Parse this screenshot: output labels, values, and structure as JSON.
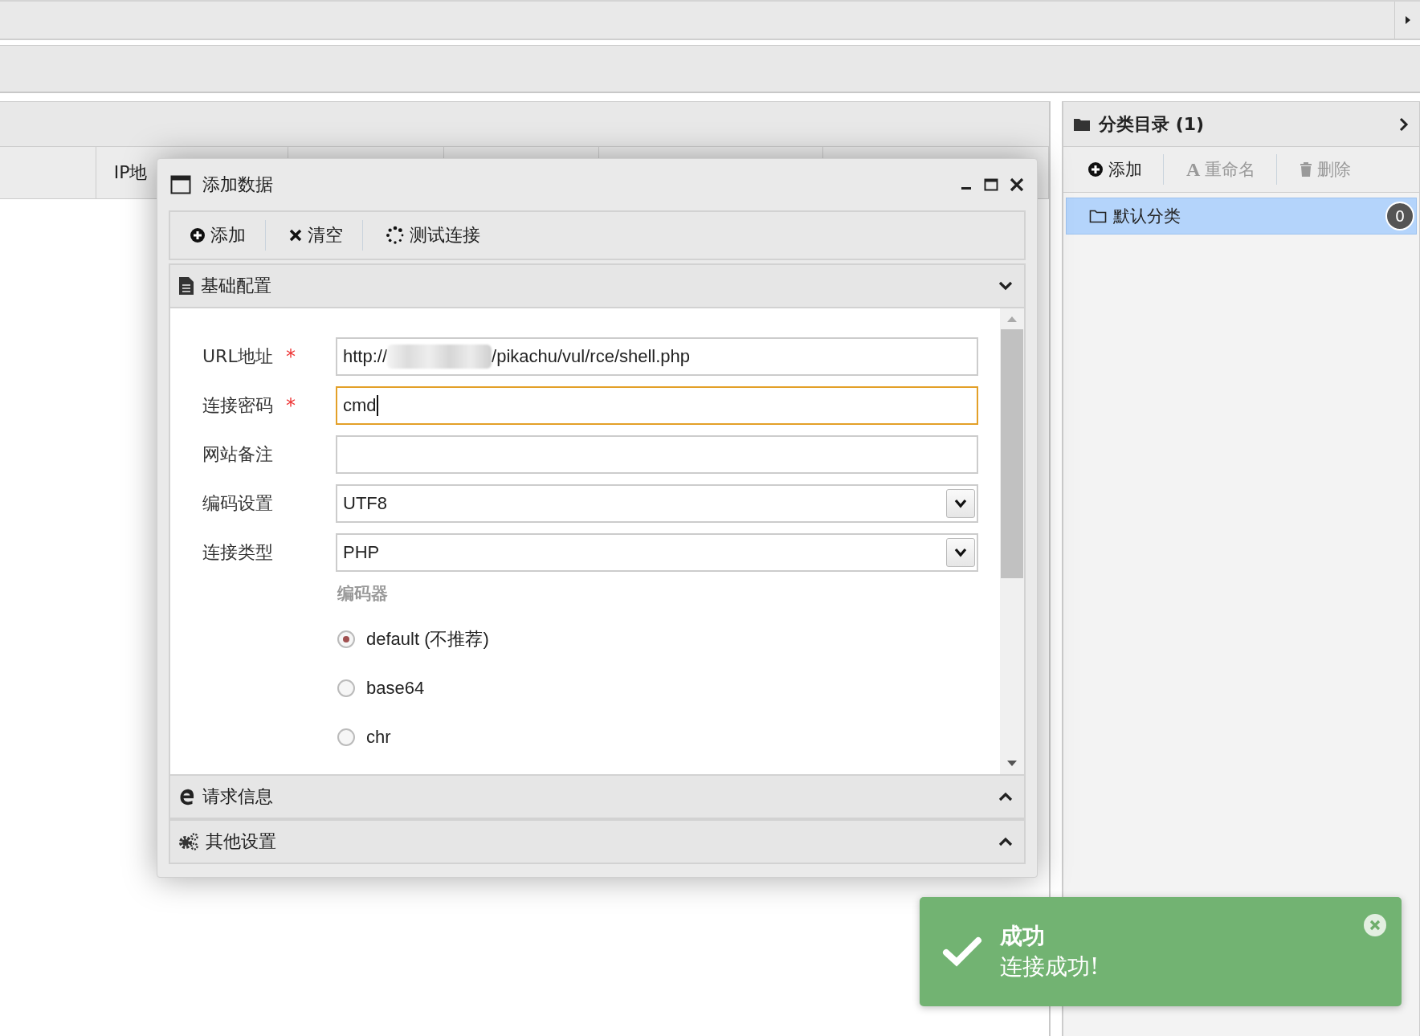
{
  "table": {
    "columns": [
      {},
      {
        "label": "IP地"
      },
      {},
      {},
      {},
      {}
    ]
  },
  "category_panel": {
    "title": "分类目录 (1)",
    "toolbar": [
      {
        "kind": "add",
        "label": "添加",
        "disabled": false
      },
      {
        "kind": "rename",
        "glyph": "A",
        "label": "重命名",
        "disabled": true
      },
      {
        "kind": "delete",
        "label": "删除",
        "disabled": true
      }
    ],
    "items": [
      {
        "label": "默认分类",
        "count": "0",
        "selected": true
      }
    ]
  },
  "dialog": {
    "title": "添加数据",
    "toolbar": [
      {
        "kind": "add",
        "label": "添加"
      },
      {
        "kind": "clear",
        "label": "清空"
      },
      {
        "kind": "test",
        "label": "测试连接"
      }
    ],
    "sections": [
      {
        "kind": "basic",
        "title": "基础配置",
        "expanded": true
      },
      {
        "kind": "request",
        "title": "请求信息",
        "expanded": false
      },
      {
        "kind": "other",
        "title": "其他设置",
        "expanded": false
      }
    ],
    "fields": [
      {
        "kind": "text",
        "label": "URL地址",
        "required_mark": "*",
        "value_before_redaction": "http://",
        "redacted": true,
        "value_after_redaction": "/pikachu/vul/rce/shell.php"
      },
      {
        "kind": "text",
        "label": "连接密码",
        "required_mark": "*",
        "value": "cmd",
        "focused": true
      },
      {
        "kind": "text",
        "label": "网站备注"
      },
      {
        "kind": "select",
        "label": "编码设置",
        "value": "UTF8"
      },
      {
        "kind": "select",
        "label": "连接类型",
        "value": "PHP"
      }
    ],
    "encoder": {
      "label": "编码器",
      "options": [
        {
          "label": "default (不推荐)",
          "selected": true
        },
        {
          "label": "base64",
          "selected": false
        },
        {
          "label": "chr",
          "selected": false
        }
      ]
    }
  },
  "toast": {
    "title": "成功",
    "message": "连接成功!"
  }
}
